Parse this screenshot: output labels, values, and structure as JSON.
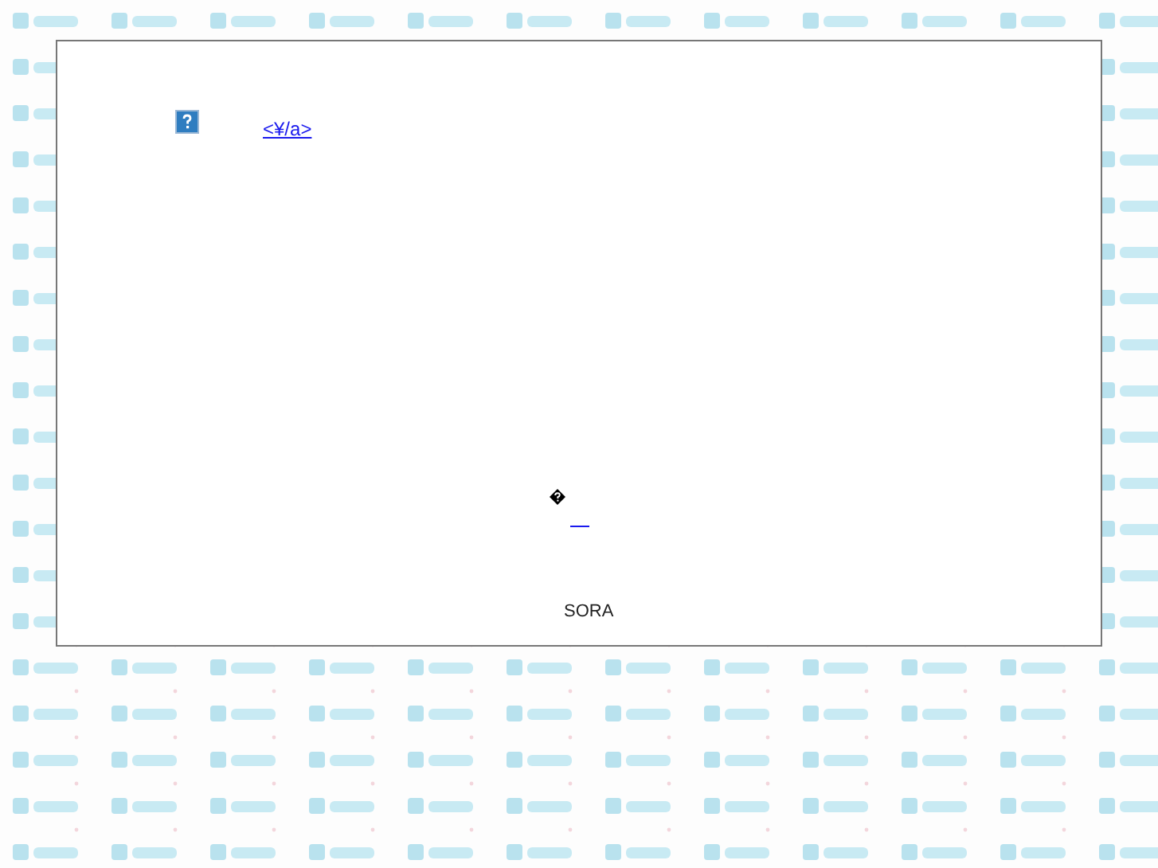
{
  "link_text": "<¥/a>",
  "footer": "SORA"
}
